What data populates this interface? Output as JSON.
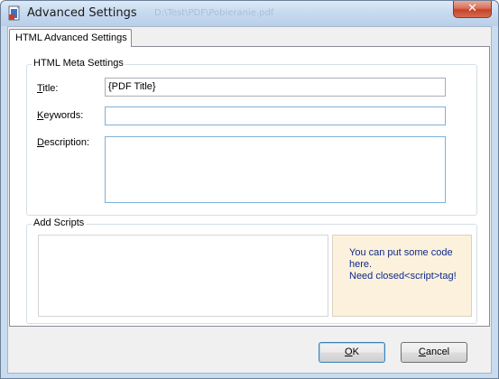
{
  "window": {
    "title": "Advanced Settings",
    "ghost_title": "D:\\Test\\PDF\\Pobieranie.pdf",
    "close_glyph": "✕"
  },
  "tabs": [
    {
      "label": "HTML Advanced Settings",
      "active": true
    }
  ],
  "meta_settings": {
    "legend": "HTML Meta Settings",
    "title_label_accel": "T",
    "title_label_rest": "itle:",
    "title_value": "{PDF Title}",
    "keywords_label_accel": "K",
    "keywords_label_rest": "eywords:",
    "keywords_value": "",
    "description_label_accel": "D",
    "description_label_rest": "escription:",
    "description_value": ""
  },
  "scripts": {
    "legend": "Add Scripts",
    "script_value": "",
    "hint_line1": "You can put some code",
    "hint_line2": "here.",
    "hint_line3": "Need closed<script>tag!"
  },
  "footer": {
    "ok_accel": "O",
    "ok_rest": "K",
    "cancel_accel": "C",
    "cancel_rest": "ancel"
  },
  "colors": {
    "titlebar": "#c6d9ef",
    "close": "#c5432a",
    "hint_bg": "#fbf1dc",
    "hint_text": "#0f2a8c"
  }
}
